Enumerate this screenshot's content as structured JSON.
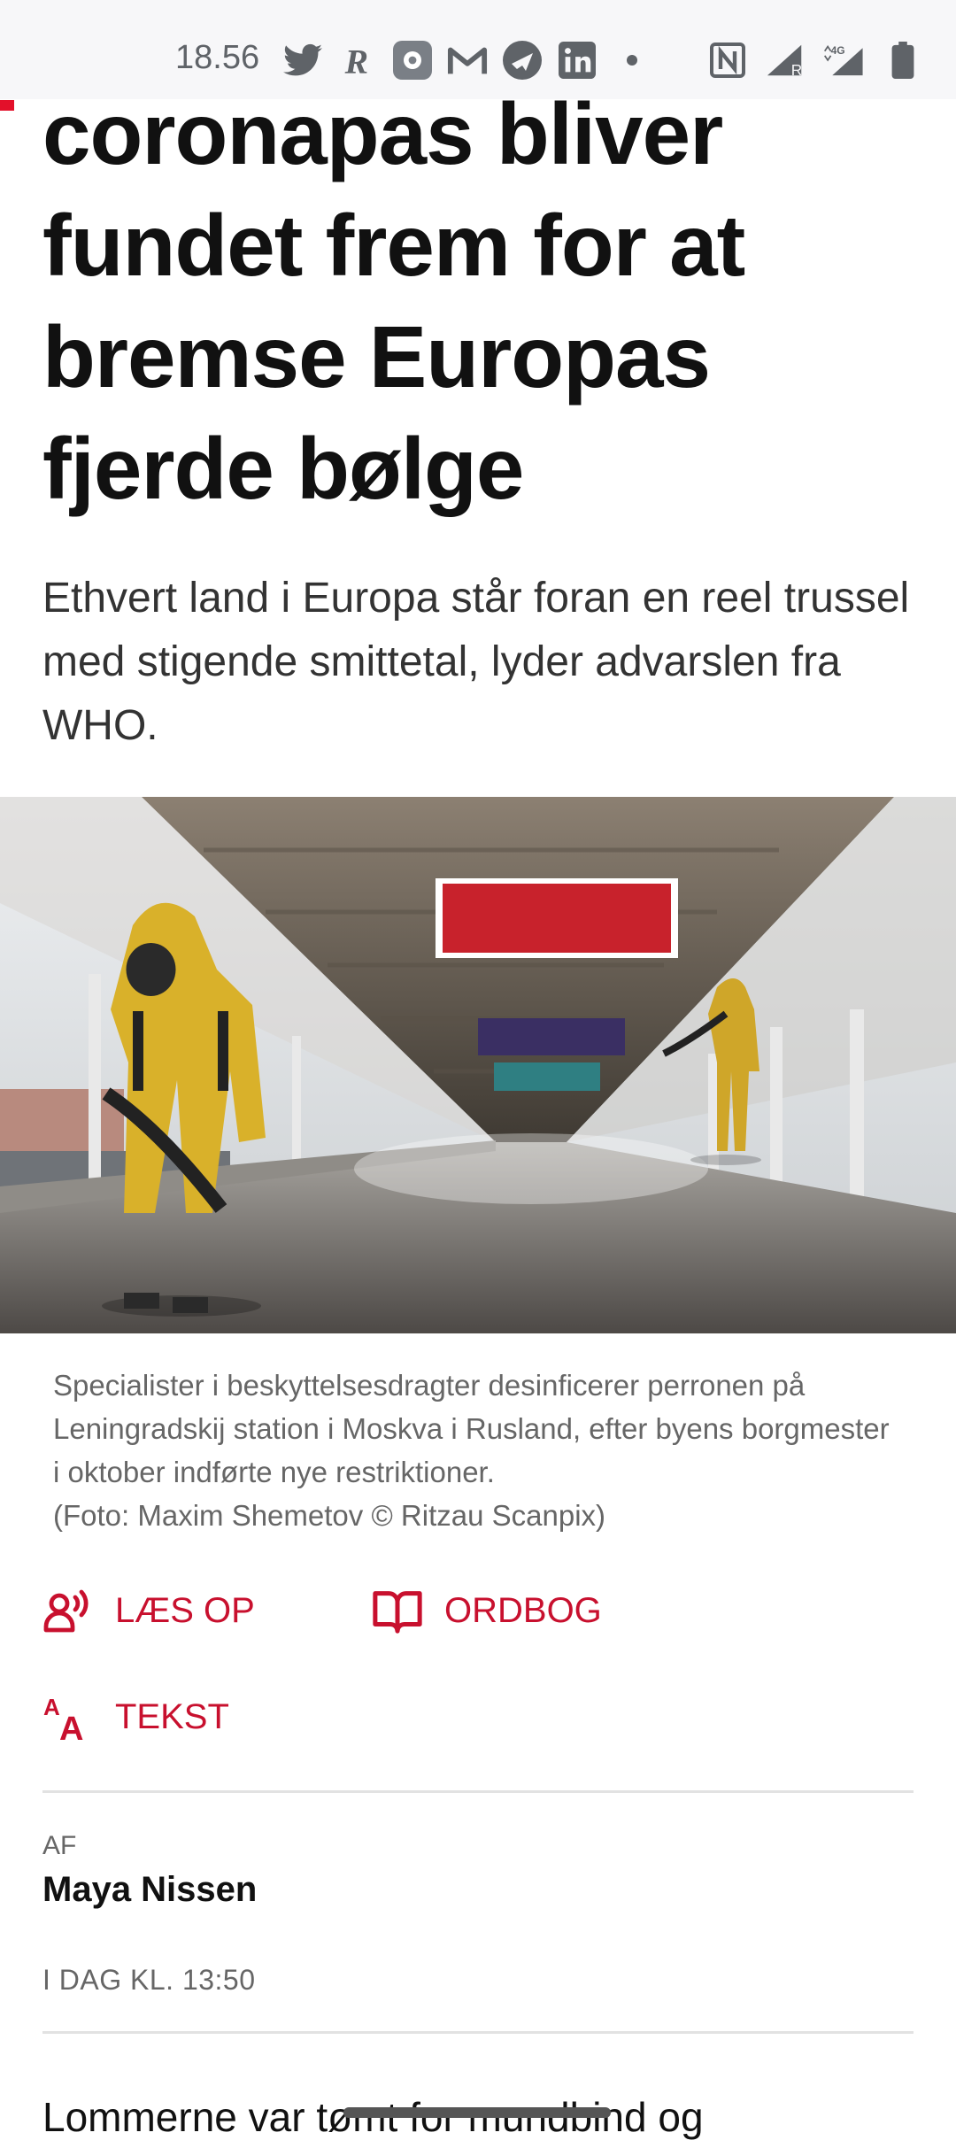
{
  "status_bar": {
    "time": "18.56",
    "icons": [
      "twitter-icon",
      "r-app-icon",
      "settings-app-icon",
      "gmail-icon",
      "airplane-app-icon",
      "linkedin-icon",
      "dot-icon",
      "nfc-icon",
      "signal-icon",
      "4g-signal-icon",
      "battery-icon"
    ]
  },
  "article": {
    "headline": "coronapas bliver fundet frem for at bremse Europas fjerde bølge",
    "subtitle": "Ethvert land i Europa står foran en reel trussel med stigende smittetal, lyder advarslen fra WHO.",
    "image_caption": "Specialister i beskyttelsesdragter desinficerer perronen på Leningradskij station i Moskva i Rusland, efter byens borgmester i oktober indførte nye restriktioner.",
    "photo_credit": "(Foto: Maxim Shemetov © Ritzau Scanpix)",
    "tools": {
      "read_aloud": "LÆS OP",
      "dictionary": "ORDBOG",
      "text_size": "TEKST"
    },
    "byline_label": "AF",
    "author": "Maya Nissen",
    "date": "I DAG KL. 13:50",
    "body_start": "Lommerne var tømt for mundbind og"
  },
  "colors": {
    "accent": "#c8102e",
    "status_bar_bg": "#f7f7f9"
  }
}
